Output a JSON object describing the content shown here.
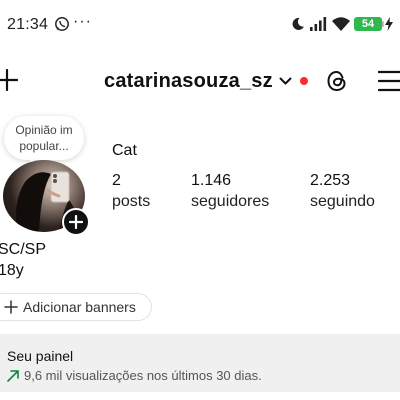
{
  "status_bar": {
    "time": "21:34",
    "dots": "···",
    "battery": "54",
    "icons": [
      "whatsapp-icon",
      "moon-icon",
      "signal-icon",
      "wifi-icon",
      "battery-icon",
      "charging-bolt-icon"
    ]
  },
  "header": {
    "username": "catarinasouza_sz",
    "icons": [
      "plus-icon",
      "chevron-down-icon",
      "notification-dot",
      "threads-icon",
      "menu-icon"
    ],
    "notification_color": "#ff2b2b"
  },
  "note": {
    "line1": "Opinião im",
    "line2": "popular..."
  },
  "profile": {
    "display_name": "Cat",
    "stats": [
      {
        "value": "2",
        "label": "posts"
      },
      {
        "value": "1.146",
        "label": "seguidores"
      },
      {
        "value": "2.253",
        "label": "seguindo"
      }
    ],
    "bio": [
      "SC/SP",
      "18y"
    ],
    "add_banners": "Adicionar banners"
  },
  "dashboard": {
    "title": "Seu painel",
    "subtitle": "9,6 mil visualizações nos últimos 30 dias.",
    "trend_color": "#0a8a3a"
  }
}
